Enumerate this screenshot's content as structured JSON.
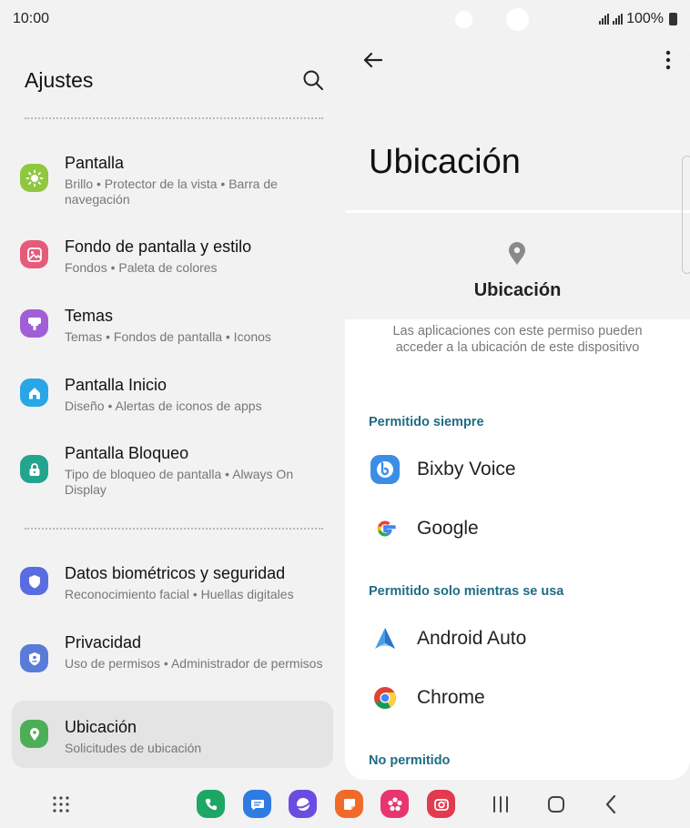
{
  "status": {
    "time": "10:00",
    "battery": "100%"
  },
  "left": {
    "title": "Ajustes",
    "items": [
      {
        "title": "Pantalla",
        "subtitle": "Brillo • Protector de la vista • Barra de navegación",
        "color": "#8fc73e"
      },
      {
        "title": "Fondo de pantalla y estilo",
        "subtitle": "Fondos • Paleta de colores",
        "color": "#e65a7a"
      },
      {
        "title": "Temas",
        "subtitle": "Temas • Fondos de pantalla • Iconos",
        "color": "#a05fd6"
      },
      {
        "title": "Pantalla Inicio",
        "subtitle": "Diseño • Alertas de iconos de apps",
        "color": "#2aa5e6"
      },
      {
        "title": "Pantalla Bloqueo",
        "subtitle": "Tipo de bloqueo de pantalla • Always On Display",
        "color": "#22a48e"
      },
      {
        "title": "Datos biométricos y seguridad",
        "subtitle": "Reconocimiento facial • Huellas digitales",
        "color": "#5a6de0"
      },
      {
        "title": "Privacidad",
        "subtitle": "Uso de permisos • Administrador de permisos",
        "color": "#5b7bd9"
      },
      {
        "title": "Ubicación",
        "subtitle": "Solicitudes de ubicación",
        "color": "#4cae56"
      }
    ]
  },
  "right": {
    "title": "Ubicación",
    "card_title": "Ubicación",
    "description": "Las aplicaciones con este permiso pueden acceder a la ubicación de este dispositivo",
    "sections": [
      {
        "heading": "Permitido siempre",
        "apps": [
          "Bixby Voice",
          "Google"
        ]
      },
      {
        "heading": "Permitido solo mientras se usa",
        "apps": [
          "Android Auto",
          "Chrome"
        ]
      },
      {
        "heading": "No permitido",
        "apps": []
      }
    ]
  },
  "colors": {
    "accent": "#1f6c86",
    "background": "#f2f2f2",
    "panel": "#ffffff"
  },
  "dock_icons": [
    "phone-icon",
    "messages-icon",
    "internet-icon",
    "notes-icon",
    "gallery-icon",
    "camera-icon"
  ],
  "nav_icons": [
    "recents-icon",
    "home-icon",
    "back-icon"
  ]
}
